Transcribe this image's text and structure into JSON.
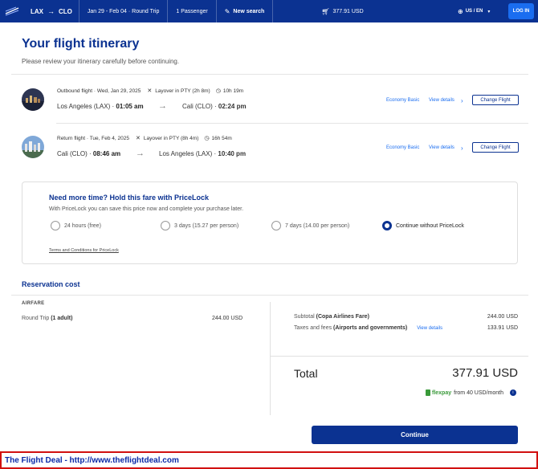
{
  "header": {
    "origin": "LAX",
    "destination": "CLO",
    "dates": "Jan 29 - Feb 04 · Round Trip",
    "passengers": "1 Passenger",
    "new_search": "New search",
    "cart_total": "377.91 USD",
    "locale": "US / EN",
    "login": "LOG IN"
  },
  "page": {
    "title": "Your flight itinerary",
    "subtitle": "Please review your itinerary carefully before continuing."
  },
  "flights": [
    {
      "label": "Outbound flight · Wed, Jan 29, 2025",
      "layover": "Layover in PTY (2h 8m)",
      "duration": "10h 19m",
      "from": "Los Angeles (LAX) · ",
      "from_time": "01:05 am",
      "to": "Cali (CLO) · ",
      "to_time": "02:24 pm",
      "fare_class": "Economy Basic",
      "view_details": "View details",
      "change": "Change Flight"
    },
    {
      "label": "Return flight · Tue, Feb 4, 2025",
      "layover": "Layover in PTY (8h 4m)",
      "duration": "16h 54m",
      "from": "Cali (CLO) · ",
      "from_time": "08:46 am",
      "to": "Los Angeles (LAX) · ",
      "to_time": "10:40 pm",
      "fare_class": "Economy Basic",
      "view_details": "View details",
      "change": "Change Flight"
    }
  ],
  "pricelock": {
    "title": "Need more time? Hold this fare with PriceLock",
    "description": "With PriceLock you can save this price now and complete your purchase later.",
    "options": [
      {
        "label": "24 hours (free)",
        "selected": false
      },
      {
        "label": "3 days (15.27 per person)",
        "selected": false
      },
      {
        "label": "7 days (14.00 per person)",
        "selected": false
      },
      {
        "label": "Continue without PriceLock",
        "selected": true
      }
    ],
    "terms": "Terms and Conditions for PriceLock"
  },
  "reservation": {
    "title": "Reservation cost",
    "airfare_heading": "AIRFARE",
    "round_trip_label": "Round Trip",
    "round_trip_qty": "(1 adult)",
    "round_trip_price": "244.00 USD",
    "subtotal_label": "Subtotal",
    "subtotal_note": "(Copa Airlines Fare)",
    "subtotal_value": "244.00 USD",
    "taxes_label": "Taxes and fees",
    "taxes_note": "(Airports and governments)",
    "taxes_details": "View details",
    "taxes_value": "133.91 USD",
    "total_label": "Total",
    "total_value": "377.91 USD",
    "flexpay_brand": "flexpay",
    "flexpay_text": "from 40 USD/month"
  },
  "actions": {
    "continue": "Continue"
  },
  "banner": {
    "text": "The Flight Deal - http://www.theflightdeal.com"
  },
  "colors": {
    "brand": "#0b3291",
    "link": "#1a6df0",
    "banner_border": "#d11010"
  }
}
